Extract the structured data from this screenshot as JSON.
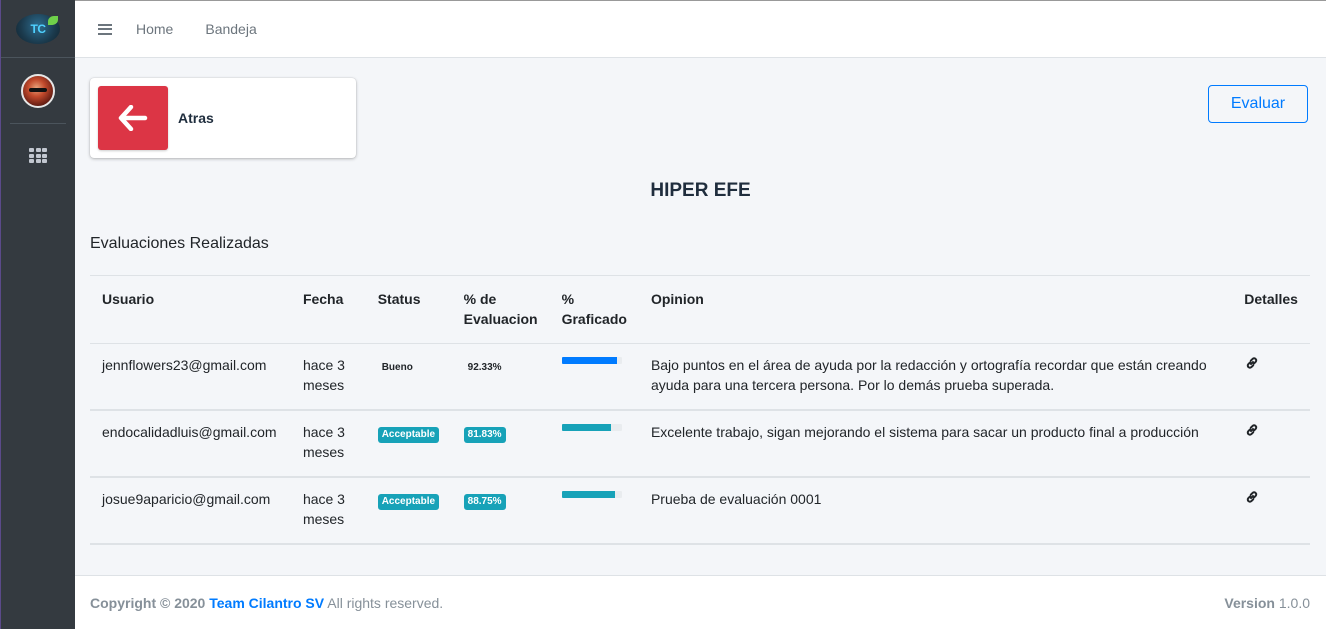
{
  "sidebar": {
    "logo_text": "TC",
    "avatar_alt": "user avatar"
  },
  "navbar": {
    "links": [
      "Home",
      "Bandeja"
    ]
  },
  "back_card": {
    "label": "Atras"
  },
  "evaluate_button": "Evaluar",
  "page_title": "HIPER EFE",
  "section_title": "Evaluaciones Realizadas",
  "table": {
    "headers": {
      "usuario": "Usuario",
      "fecha": "Fecha",
      "status": "Status",
      "evaluacion_1": "% de",
      "evaluacion_2": "Evaluacion",
      "graficado_1": "%",
      "graficado_2": "Graficado",
      "opinion": "Opinion",
      "detalles": "Detalles"
    },
    "rows": [
      {
        "usuario": "jennflowers23@gmail.com",
        "fecha_1": "hace 3",
        "fecha_2": "meses",
        "status": "Bueno",
        "porcentaje": "92.33%",
        "progress": 0.9233,
        "opinion": "Bajo puntos en el área de ayuda por la redacción y ortografía recordar que están creando ayuda para una tercera persona. Por lo demás prueba superada."
      },
      {
        "usuario": "endocalidadluis@gmail.com",
        "fecha_1": "hace 3",
        "fecha_2": "meses",
        "status": "Acceptable",
        "porcentaje": "81.83%",
        "progress": 0.8183,
        "opinion": "Excelente trabajo, sigan mejorando el sistema para sacar un producto final a producción"
      },
      {
        "usuario": "josue9aparicio@gmail.com",
        "fecha_1": "hace 3",
        "fecha_2": "meses",
        "status": "Acceptable",
        "porcentaje": "88.75%",
        "progress": 0.8875,
        "opinion": "Prueba de evaluación 0001"
      }
    ]
  },
  "footer": {
    "copyright": "Copyright © 2020",
    "brand": "Team Cilantro SV",
    "rights": "All rights reserved.",
    "version_label": "Version",
    "version_value": "1.0.0"
  },
  "colors": {
    "primary": "#007bff",
    "danger": "#dc3545",
    "info": "#17a2b8",
    "sidebar": "#343a40"
  }
}
